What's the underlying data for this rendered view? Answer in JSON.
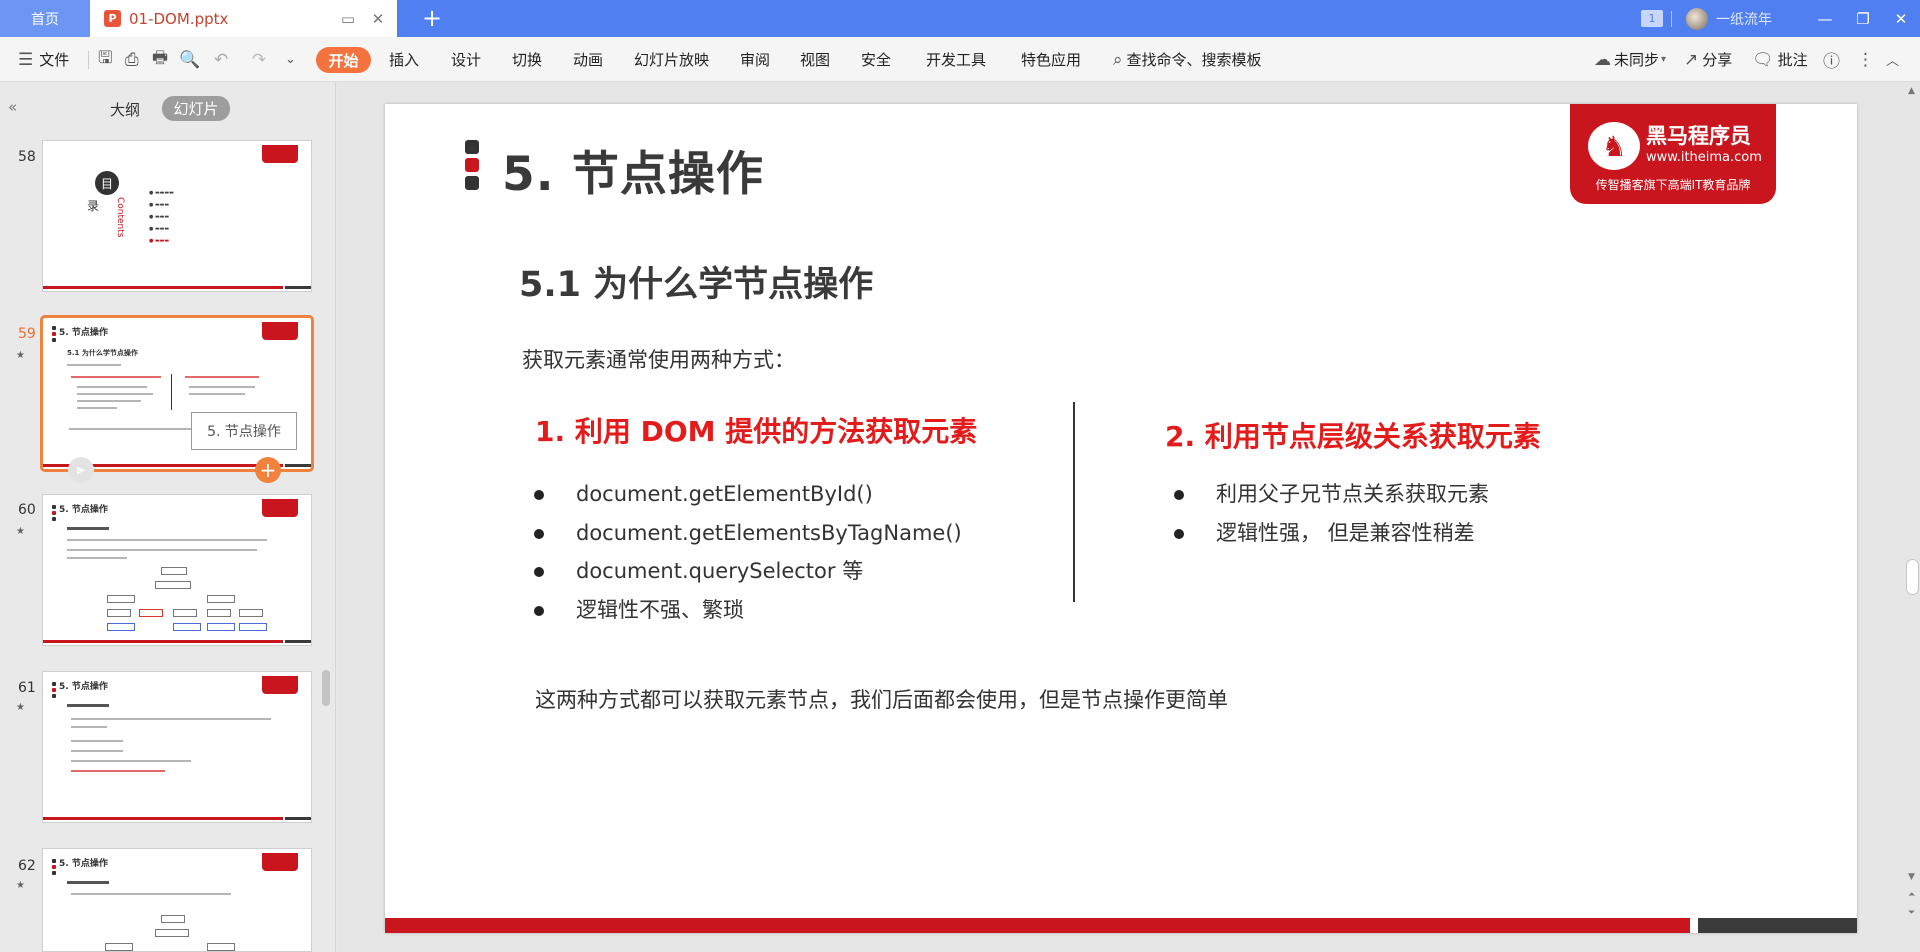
{
  "titlebar": {
    "home_tab": "首页",
    "doc_tab": "01-DOM.pptx",
    "doc_icon": "P",
    "window_count": "1",
    "username": "一纸流年"
  },
  "ribbon": {
    "file": "文件",
    "start": "开始",
    "tabs": [
      "插入",
      "设计",
      "切换",
      "动画",
      "幻灯片放映",
      "审阅",
      "视图",
      "安全",
      "开发工具",
      "特色应用"
    ],
    "search": "查找命令、搜索模板",
    "sync": "未同步",
    "share": "分享",
    "comment": "批注"
  },
  "leftpane": {
    "outline": "大纲",
    "slides": "幻灯片",
    "slide_numbers": [
      "58",
      "59",
      "60",
      "61",
      "62"
    ],
    "tooltip": "5. 节点操作"
  },
  "thumbs": {
    "toc_title_a": "目",
    "toc_title_b": "录",
    "toc_contents": "Contents"
  },
  "slide": {
    "title": "5. 节点操作",
    "logo_brand": "黑马程序员",
    "logo_url": "www.itheima.com",
    "logo_slogan": "传智播客旗下高端IT教育品牌",
    "subtitle": "5.1 为什么学节点操作",
    "intro": "获取元素通常使用两种方式：",
    "left_heading": "1. 利用 DOM 提供的方法获取元素",
    "left_items": [
      "document.getElementById()",
      "document.getElementsByTagName()",
      "document.querySelector  等",
      "逻辑性不强、繁琐"
    ],
    "right_heading": "2. 利用节点层级关系获取元素",
    "right_items": [
      "利用父子兄节点关系获取元素",
      "逻辑性强，  但是兼容性稍差"
    ],
    "footer": "这两种方式都可以获取元素节点，我们后面都会使用，但是节点操作更简单"
  },
  "colors": {
    "titlebar": "#4f7ff1",
    "accent_orange": "#f4723e",
    "brand_red": "#c9151e",
    "heading_red": "#e31b1b"
  }
}
